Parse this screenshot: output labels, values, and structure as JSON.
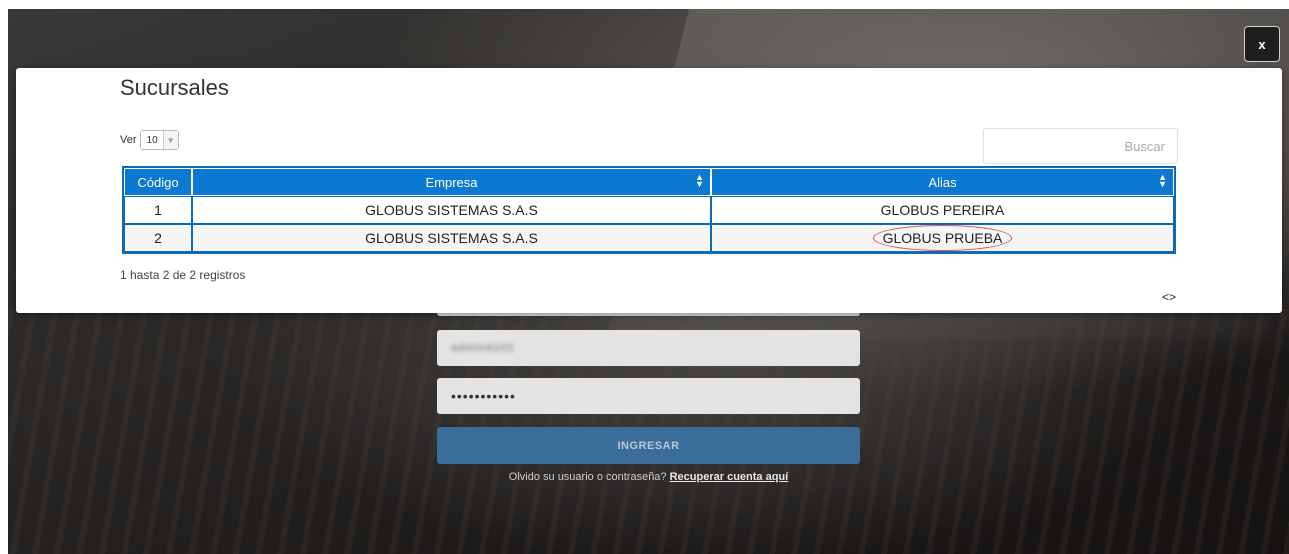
{
  "modal": {
    "title": "Sucursales",
    "close_label": "x",
    "length": {
      "label": "Ver",
      "value": "10"
    },
    "search": {
      "placeholder": "Buscar"
    },
    "table": {
      "headers": [
        "Código",
        "Empresa",
        "Alias"
      ],
      "rows": [
        {
          "code": "1",
          "empresa": "GLOBUS SISTEMAS S.A.S",
          "alias": "GLOBUS PEREIRA"
        },
        {
          "code": "2",
          "empresa": "GLOBUS SISTEMAS S.A.S",
          "alias": "GLOBUS PRUEBA"
        }
      ]
    },
    "info": "1 hasta 2 de 2 registros",
    "pager": "<>"
  },
  "login": {
    "username_blurred": "admin4102",
    "password_masked": "•••••••••••",
    "submit_label": "INGRESAR",
    "recover_text": "Olvido su usuario o contraseña?",
    "recover_link": "Recuperar cuenta aquí"
  },
  "colors": {
    "table_header": "#0b78d1",
    "table_border": "#0d6ab7",
    "login_button": "#3a6d9a",
    "highlight": "#d9534f"
  }
}
